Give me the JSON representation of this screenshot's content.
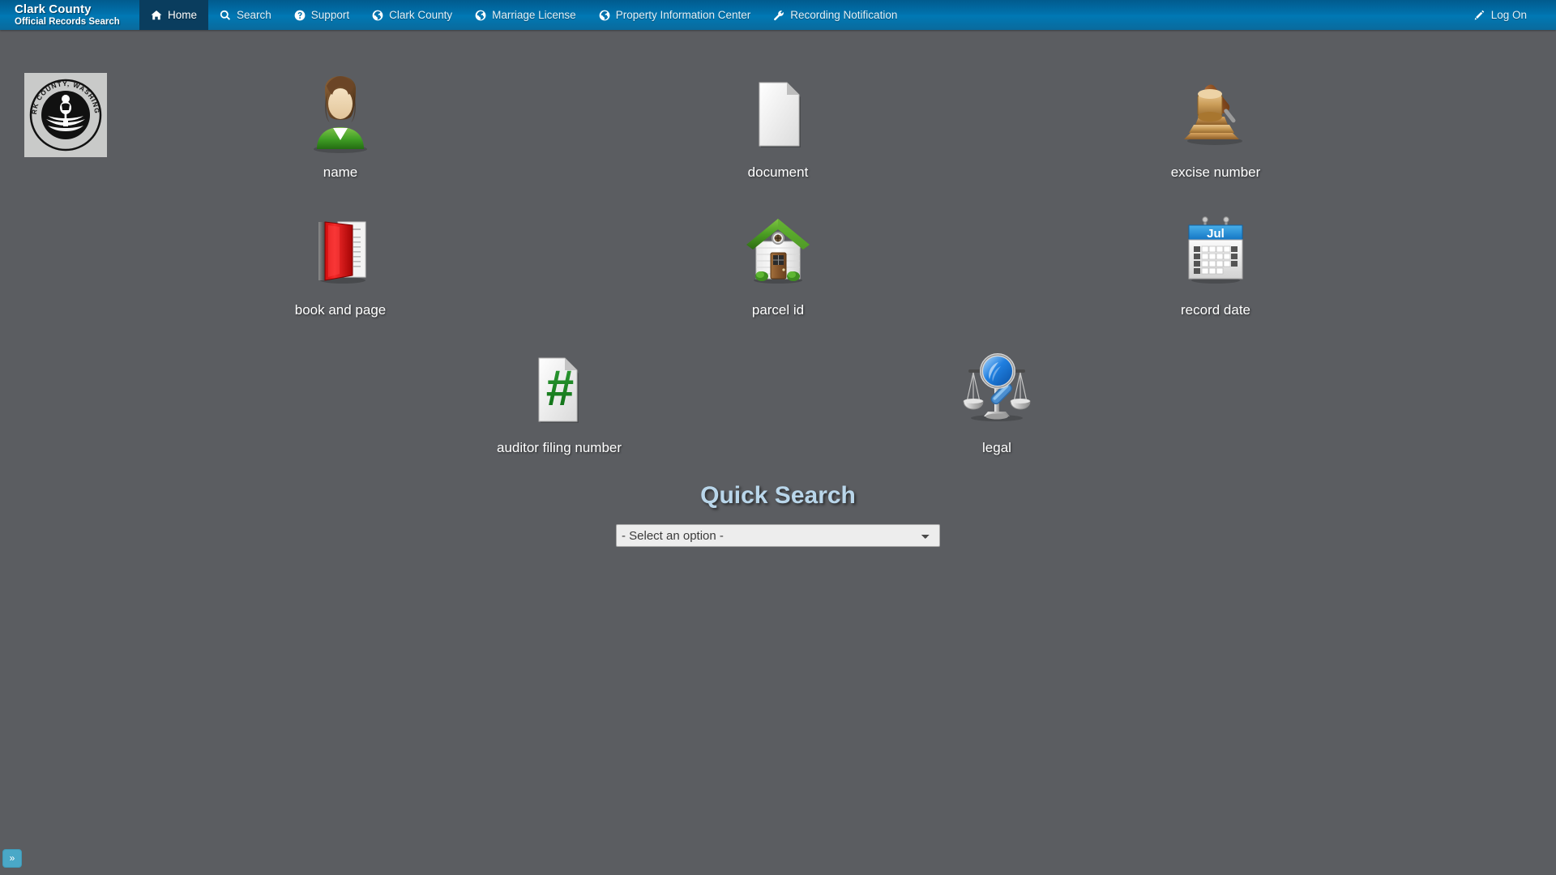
{
  "header": {
    "brand_title": "Clark County",
    "brand_subtitle": "Official Records Search",
    "nav_items": [
      {
        "label": "Home",
        "icon": "home-icon",
        "active": true
      },
      {
        "label": "Search",
        "icon": "search-icon",
        "active": false
      },
      {
        "label": "Support",
        "icon": "question-circle-icon",
        "active": false
      },
      {
        "label": "Clark County",
        "icon": "globe-icon",
        "active": false
      },
      {
        "label": "Marriage License",
        "icon": "globe-icon",
        "active": false
      },
      {
        "label": "Property Information Center",
        "icon": "globe-icon",
        "active": false
      },
      {
        "label": "Recording Notification",
        "icon": "wrench-icon",
        "active": false
      }
    ],
    "log_on_label": "Log On",
    "log_on_icon": "pencil-icon"
  },
  "seal": {
    "icon": "clark-county-washington-seal",
    "text": "CLARK COUNTY, WASHINGTON"
  },
  "search_categories": [
    {
      "label": "name",
      "icon": "person-icon"
    },
    {
      "label": "document",
      "icon": "document-icon"
    },
    {
      "label": "excise number",
      "icon": "gavel-icon"
    },
    {
      "label": "book and page",
      "icon": "red-book-icon"
    },
    {
      "label": "parcel id",
      "icon": "house-icon"
    },
    {
      "label": "record date",
      "icon": "calendar-icon"
    },
    {
      "label": "auditor filing number",
      "icon": "hash-document-icon"
    },
    {
      "label": "legal",
      "icon": "scales-magnifier-icon"
    }
  ],
  "quick_search": {
    "title": "Quick Search",
    "select_value": "- Select an option -",
    "options": [
      "- Select an option -"
    ]
  },
  "footer": {
    "expand_label": "»"
  },
  "colors": {
    "page_background": "#5b5d61",
    "navbar_blue": "#0173ae",
    "navbar_active": "#0a3d5e",
    "quick_search_title": "#b9d6ea",
    "expand_button": "#4aa8c7"
  }
}
